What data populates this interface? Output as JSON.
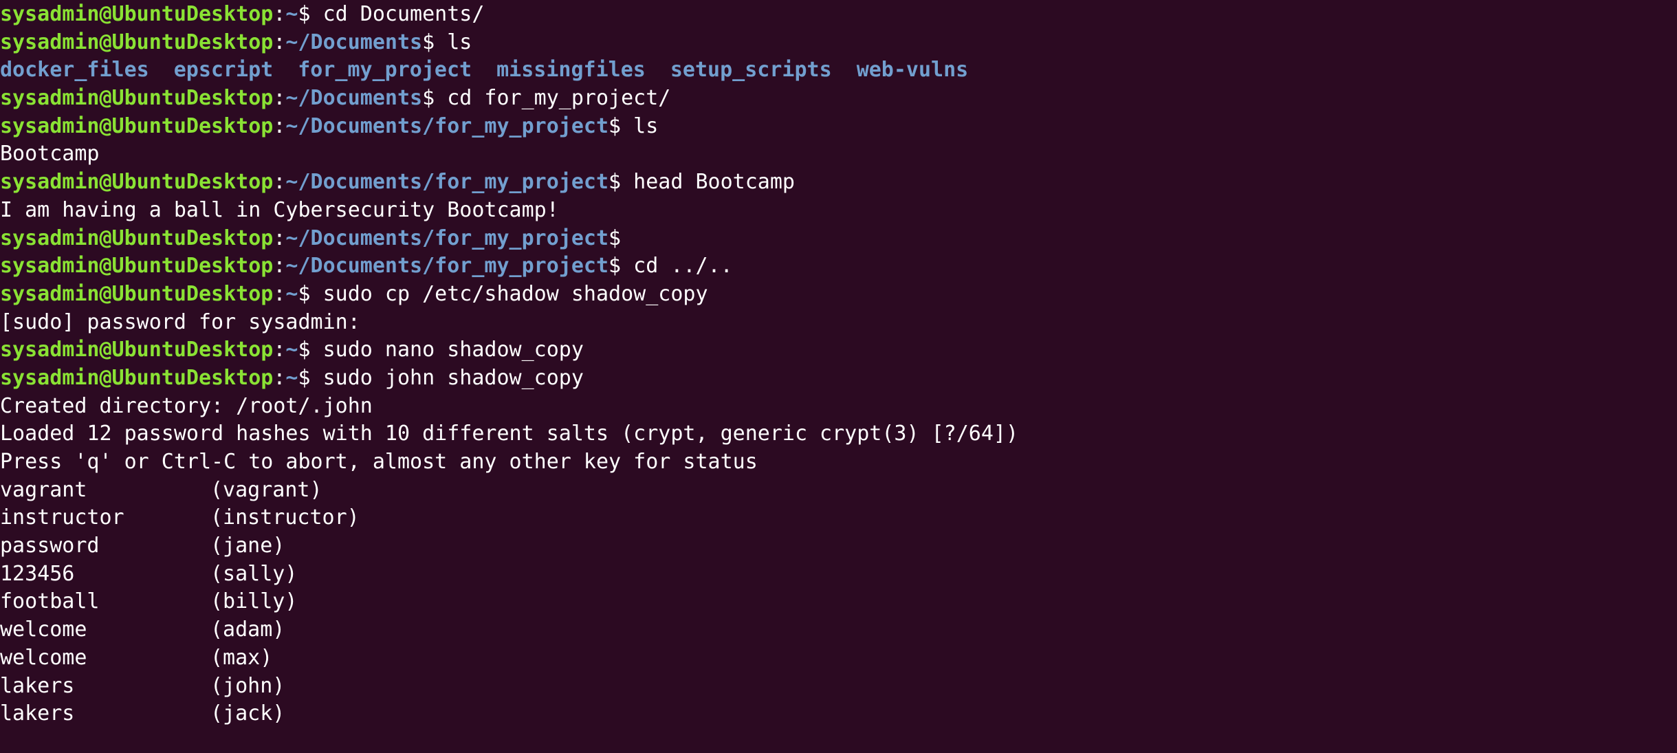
{
  "colors": {
    "background": "#2c0a22",
    "prompt_user": "#8ae234",
    "prompt_path": "#729fcf",
    "text": "#ffffff",
    "directory": "#729fcf"
  },
  "prompt_user": "sysadmin@UbuntuDesktop",
  "lines": [
    {
      "type": "prompt",
      "path": "~",
      "cmd": " cd Documents/"
    },
    {
      "type": "prompt",
      "path": "~/Documents",
      "cmd": " ls"
    },
    {
      "type": "ls",
      "items": [
        "docker_files",
        "epscript",
        "for_my_project",
        "missingfiles",
        "setup_scripts",
        "web-vulns"
      ]
    },
    {
      "type": "prompt",
      "path": "~/Documents",
      "cmd": " cd for_my_project/"
    },
    {
      "type": "prompt",
      "path": "~/Documents/for_my_project",
      "cmd": " ls"
    },
    {
      "type": "out",
      "text": "Bootcamp"
    },
    {
      "type": "prompt",
      "path": "~/Documents/for_my_project",
      "cmd": " head Bootcamp"
    },
    {
      "type": "out",
      "text": "I am having a ball in Cybersecurity Bootcamp!"
    },
    {
      "type": "prompt",
      "path": "~/Documents/for_my_project",
      "cmd": ""
    },
    {
      "type": "prompt",
      "path": "~/Documents/for_my_project",
      "cmd": " cd ../.."
    },
    {
      "type": "prompt",
      "path": "~",
      "cmd": " sudo cp /etc/shadow shadow_copy"
    },
    {
      "type": "out",
      "text": "[sudo] password for sysadmin:"
    },
    {
      "type": "prompt",
      "path": "~",
      "cmd": " sudo nano shadow_copy"
    },
    {
      "type": "prompt",
      "path": "~",
      "cmd": " sudo john shadow_copy"
    },
    {
      "type": "out",
      "text": "Created directory: /root/.john"
    },
    {
      "type": "out",
      "text": "Loaded 12 password hashes with 10 different salts (crypt, generic crypt(3) [?/64])"
    },
    {
      "type": "out",
      "text": "Press 'q' or Ctrl-C to abort, almost any other key for status"
    },
    {
      "type": "crack",
      "password": "vagrant",
      "user": "(vagrant)"
    },
    {
      "type": "crack",
      "password": "instructor",
      "user": "(instructor)"
    },
    {
      "type": "crack",
      "password": "password",
      "user": "(jane)"
    },
    {
      "type": "crack",
      "password": "123456",
      "user": "(sally)"
    },
    {
      "type": "crack",
      "password": "football",
      "user": "(billy)"
    },
    {
      "type": "crack",
      "password": "welcome",
      "user": "(adam)"
    },
    {
      "type": "crack",
      "password": "welcome",
      "user": "(max)"
    },
    {
      "type": "crack",
      "password": "lakers",
      "user": "(john)"
    },
    {
      "type": "crack",
      "password": "lakers",
      "user": "(jack)"
    }
  ]
}
